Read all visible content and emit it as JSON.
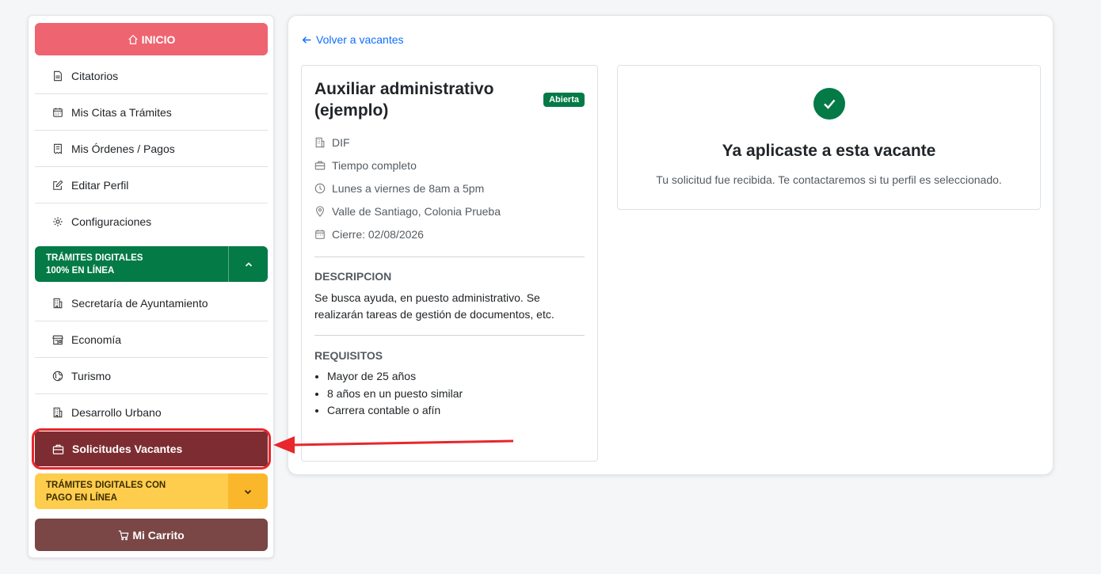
{
  "sidebar": {
    "inicio_label": "INICIO",
    "items": [
      {
        "label": "Citatorios",
        "icon": "file-icon"
      },
      {
        "label": "Mis Citas a Trámites",
        "icon": "calendar-icon"
      },
      {
        "label": "Mis Órdenes / Pagos",
        "icon": "receipt-icon"
      },
      {
        "label": "Editar Perfil",
        "icon": "edit-icon"
      },
      {
        "label": "Configuraciones",
        "icon": "gear-icon"
      }
    ],
    "section_digital": {
      "line1": "TRÁMITES DIGITALES",
      "line2": "100% EN LÍNEA"
    },
    "digital_items": [
      {
        "label": "Secretaría de Ayuntamiento",
        "icon": "building-icon"
      },
      {
        "label": "Economía",
        "icon": "shop-icon"
      },
      {
        "label": "Turismo",
        "icon": "globe-icon"
      },
      {
        "label": "Desarrollo Urbano",
        "icon": "building-icon"
      }
    ],
    "active_item": {
      "label": "Solicitudes Vacantes",
      "icon": "briefcase-icon"
    },
    "section_pago": {
      "line1": "TRÁMITES DIGITALES CON",
      "line2": "PAGO EN LÍNEA"
    },
    "carrito_label": "Mi Carrito"
  },
  "main": {
    "back_label": "Volver a vacantes",
    "job": {
      "title": "Auxiliar administrativo (ejemplo)",
      "badge": "Abierta",
      "department": "DIF",
      "schedule_type": "Tiempo completo",
      "hours": "Lunes a viernes de 8am a 5pm",
      "location": "Valle de Santiago, Colonia Prueba",
      "closing": "Cierre: 02/08/2026",
      "description_heading": "DESCRIPCION",
      "description": "Se busca ayuda, en puesto administrativo. Se realizarán tareas de gestión de documentos, etc.",
      "requirements_heading": "REQUISITOS",
      "requirements": [
        "Mayor de 25 años",
        "8 años en un puesto similar",
        "Carrera contable o afín"
      ]
    },
    "status": {
      "title": "Ya aplicaste a esta vacante",
      "text": "Tu solicitud fue recibida. Te contactaremos si tu perfil es seleccionado."
    }
  },
  "colors": {
    "inicio": "#ee6470",
    "green": "#047a47",
    "active": "#7d2d31",
    "yellow": "#ffcd4d",
    "carrito": "#7a4646",
    "link": "#0d6efd",
    "annotation": "#e8262c"
  }
}
